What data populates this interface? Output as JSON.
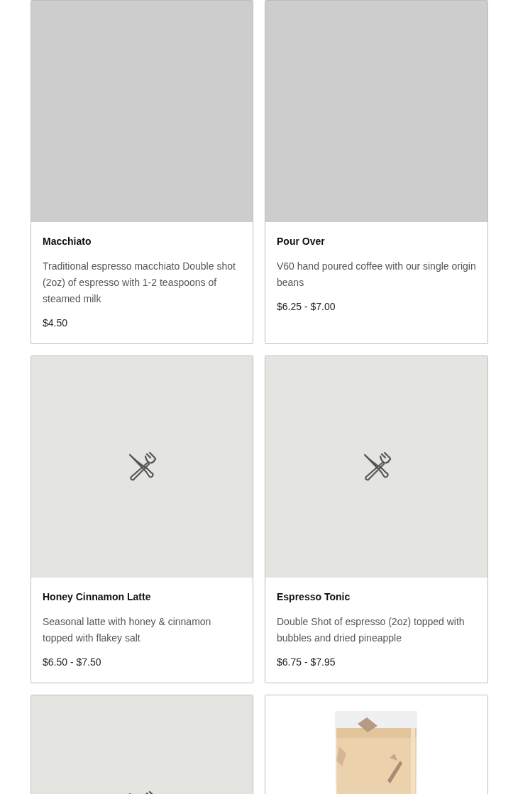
{
  "menu_items": [
    {
      "image": {
        "kind": "blank"
      },
      "name": "Macchiato",
      "description": "Traditional espresso macchiato Double shot (2oz) of espresso with 1-2 teaspoons of steamed milk",
      "price": "$4.50"
    },
    {
      "image": {
        "kind": "blank"
      },
      "name": "Pour Over",
      "description": "V60 hand poured coffee with our single origin beans",
      "price": "$6.25 - $7.00"
    },
    {
      "image": {
        "kind": "placeholder"
      },
      "name": "Honey Cinnamon Latte",
      "description": "Seasonal latte with honey & cinnamon topped with flakey salt",
      "price": "$6.50 - $7.50"
    },
    {
      "image": {
        "kind": "placeholder"
      },
      "name": "Espresso Tonic",
      "description": "Double Shot of espresso (2oz) topped with bubbles and dried pineapple",
      "price": "$6.75 - $7.95"
    },
    {
      "image": {
        "kind": "placeholder"
      }
    },
    {
      "image": {
        "kind": "picture"
      }
    }
  ]
}
